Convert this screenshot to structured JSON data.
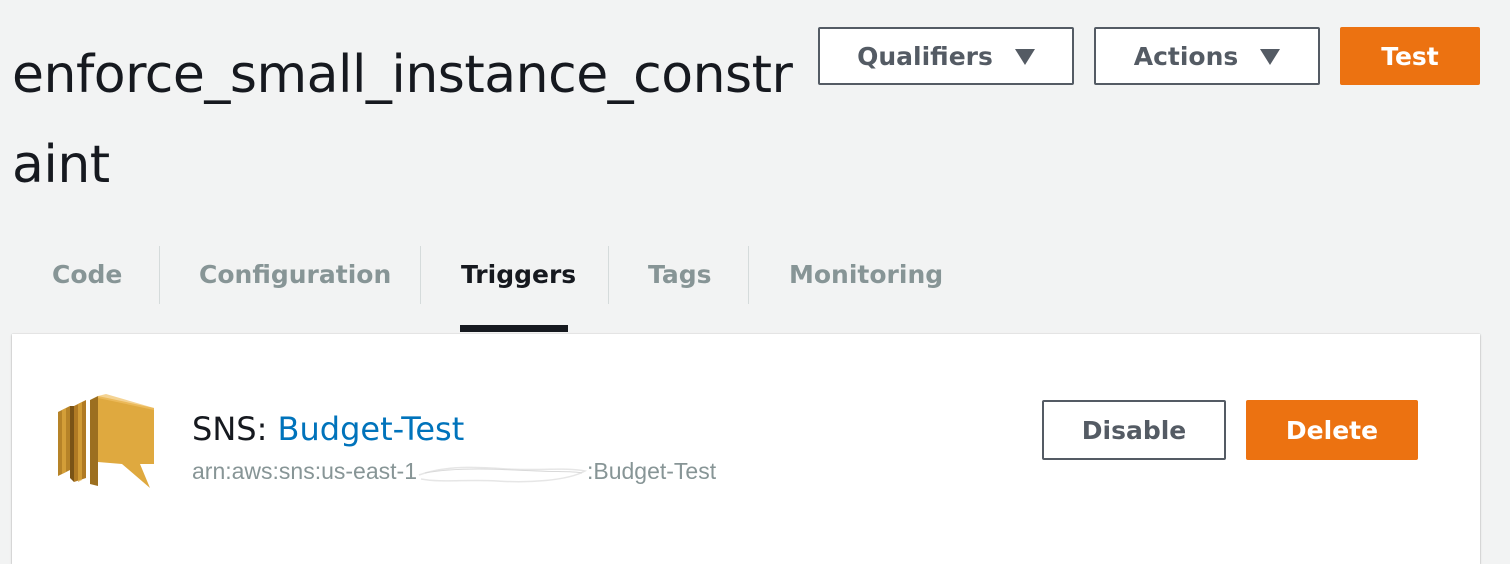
{
  "header": {
    "title": "enforce_small_instance_constraint",
    "qualifiers_label": "Qualifiers",
    "actions_label": "Actions",
    "test_label": "Test"
  },
  "tabs": [
    {
      "label": "Code",
      "active": false
    },
    {
      "label": "Configuration",
      "active": false
    },
    {
      "label": "Triggers",
      "active": true
    },
    {
      "label": "Tags",
      "active": false
    },
    {
      "label": "Monitoring",
      "active": false
    }
  ],
  "trigger": {
    "type_prefix": "SNS: ",
    "name": "Budget-Test",
    "arn_prefix": "arn:aws:sns:us-east-1",
    "arn_suffix": ":Budget-Test",
    "icon": "sns-icon",
    "disable_label": "Disable",
    "delete_label": "Delete"
  },
  "colors": {
    "accent": "#ec7211",
    "link": "#0073bb",
    "sns_icon_primary": "#dfa93f",
    "sns_icon_shadow": "#9c6f20"
  }
}
